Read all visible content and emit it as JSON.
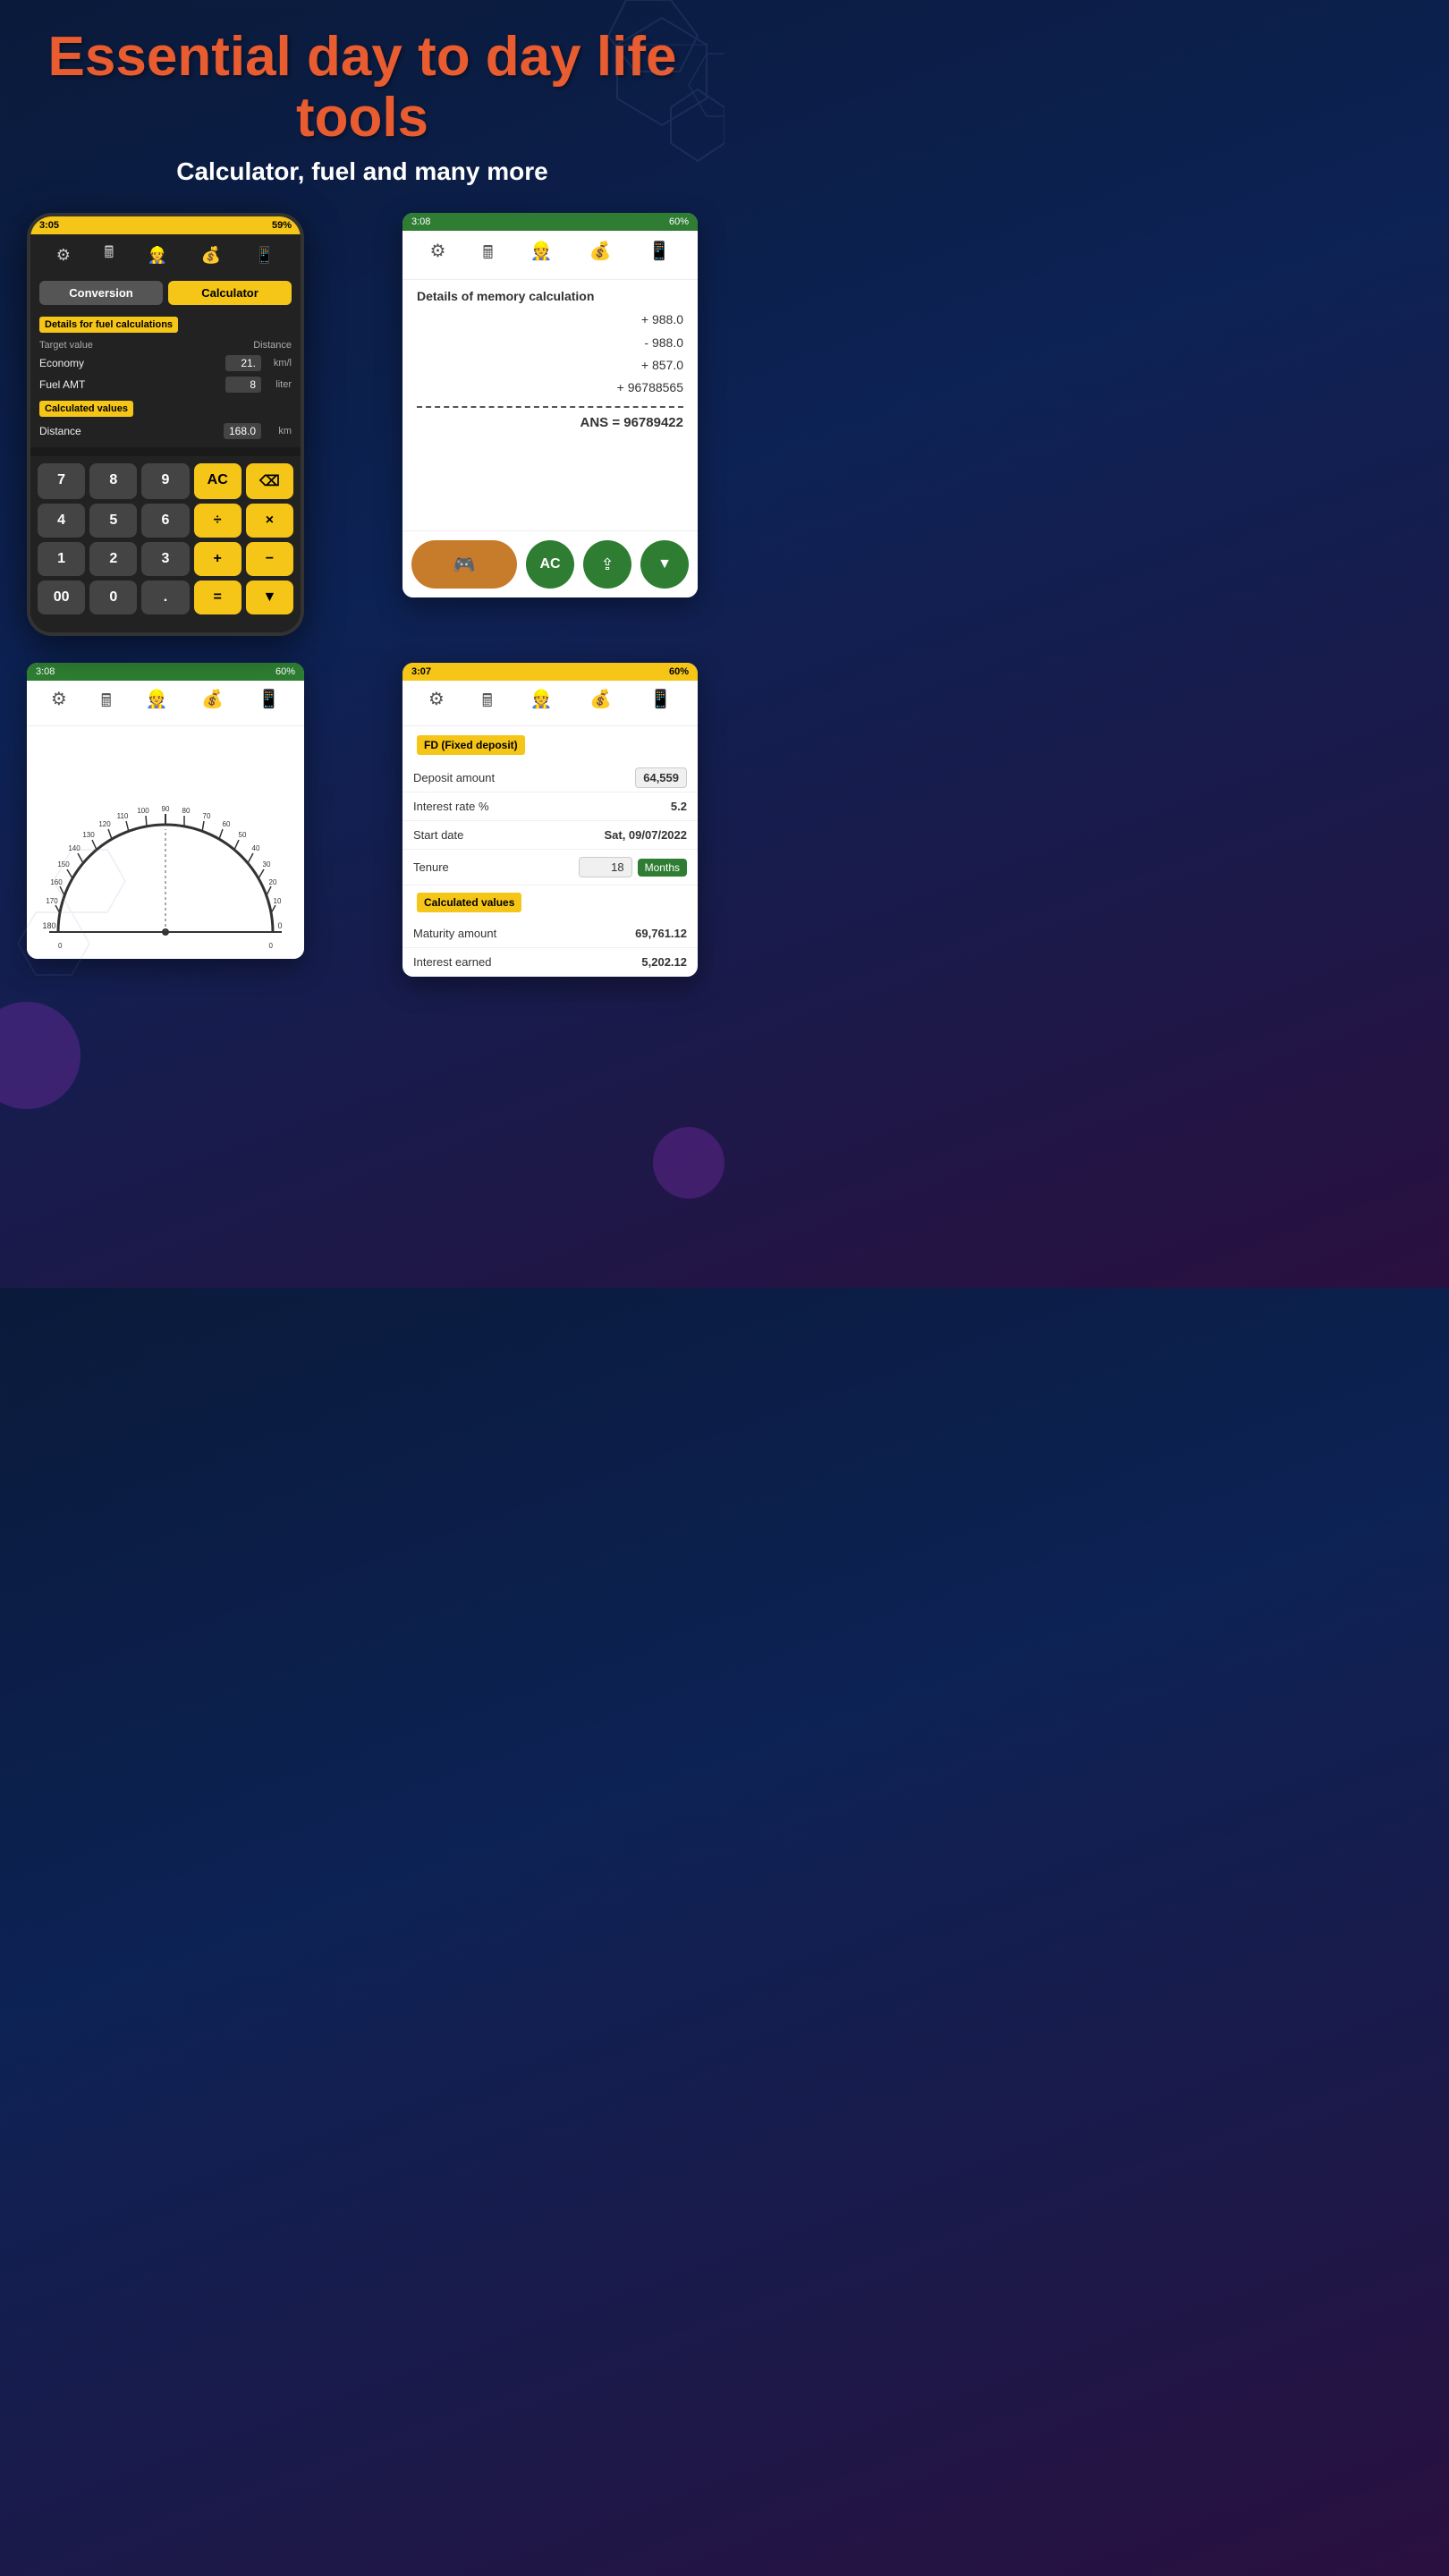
{
  "hero": {
    "title": "Essential day to day life tools",
    "subtitle": "Calculator, fuel and many more"
  },
  "phone_left": {
    "status_time": "3:05",
    "status_right": "59%",
    "tabs": {
      "conversion": "Conversion",
      "calculator": "Calculator"
    },
    "fuel": {
      "header": "Details for fuel calculations",
      "col1": "Target value",
      "col2": "Distance",
      "economy_label": "Economy",
      "economy_value": "21.",
      "economy_unit": "km/l",
      "fuel_label": "Fuel AMT",
      "fuel_value": "8",
      "fuel_unit": "liter",
      "calculated_header": "Calculated values",
      "distance_label": "Distance",
      "distance_value": "168.0",
      "distance_unit": "km"
    },
    "keypad": {
      "keys": [
        "7",
        "8",
        "9",
        "AC",
        "⌫",
        "4",
        "5",
        "6",
        "÷",
        "×",
        "1",
        "2",
        "3",
        "+",
        "-",
        "00",
        "0",
        ".",
        "=",
        "▼"
      ]
    }
  },
  "phone_right": {
    "status_time": "3:08",
    "status_right": "60%",
    "memory": {
      "title": "Details of memory calculation",
      "lines": [
        "+ 988.0",
        "- 988.0",
        "+ 857.0",
        "+ 96788565"
      ],
      "answer": "ANS = 96789422"
    },
    "buttons": {
      "game": "🎮",
      "ac": "AC",
      "share": "⇪",
      "down": "▼"
    }
  },
  "phone_proto": {
    "status_time": "3:08",
    "status_right": "60%"
  },
  "phone_fd": {
    "status_time": "3:07",
    "status_right": "60%",
    "fd_header": "FD (Fixed deposit)",
    "deposit_label": "Deposit amount",
    "deposit_value": "64,559",
    "interest_label": "Interest rate %",
    "interest_value": "5.2",
    "start_label": "Start date",
    "start_value": "Sat, 09/07/2022",
    "tenure_label": "Tenure",
    "tenure_value": "18",
    "tenure_unit": "Months",
    "calc_header": "Calculated values",
    "maturity_label": "Maturity amount",
    "maturity_value": "69,761.12",
    "interest_earned_label": "Interest earned",
    "interest_earned_value": "5,202.12"
  },
  "icons": {
    "gear": "⚙",
    "calculator": "🖩",
    "person": "👷",
    "bag": "💰",
    "phone": "📱"
  }
}
